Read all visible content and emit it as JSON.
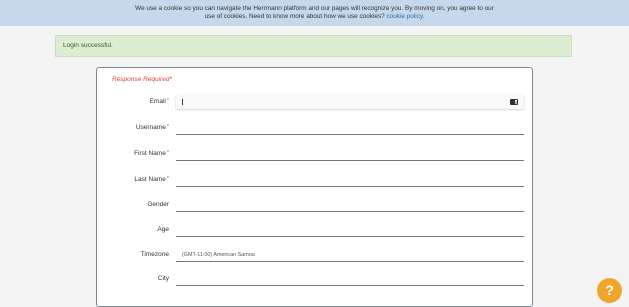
{
  "cookie_banner": {
    "line1": "We use a cookie so you can navigate the Herrmann platform and our pages will recognize you. By moving on, you agree to our",
    "line2": "use of cookies. Need to know more about how we use cookies?",
    "link": "cookie policy."
  },
  "alert": {
    "message": "Login successful."
  },
  "form": {
    "required_note": "Response Required",
    "required_marker": "*",
    "fields": [
      {
        "label": "Email",
        "required": true,
        "value": ""
      },
      {
        "label": "Username",
        "required": true,
        "value": ""
      },
      {
        "label": "First Name",
        "required": true,
        "value": ""
      },
      {
        "label": "Last Name",
        "required": true,
        "value": ""
      },
      {
        "label": "Gender",
        "required": false,
        "value": ""
      },
      {
        "label": "Age",
        "required": false,
        "value": ""
      },
      {
        "label": "Timezone",
        "required": false,
        "value": "(GMT-11:00) American Samoa"
      },
      {
        "label": "City",
        "required": false,
        "value": ""
      }
    ]
  },
  "help": {
    "glyph": "?"
  },
  "icons": {
    "email_field_icon": "contact-card-icon",
    "help_icon": "question-icon"
  },
  "colors": {
    "accent": "#f0a52c",
    "required": "#d4493b",
    "alert_bg": "#dcedd2",
    "cookie_bg": "#c6d9ec"
  }
}
